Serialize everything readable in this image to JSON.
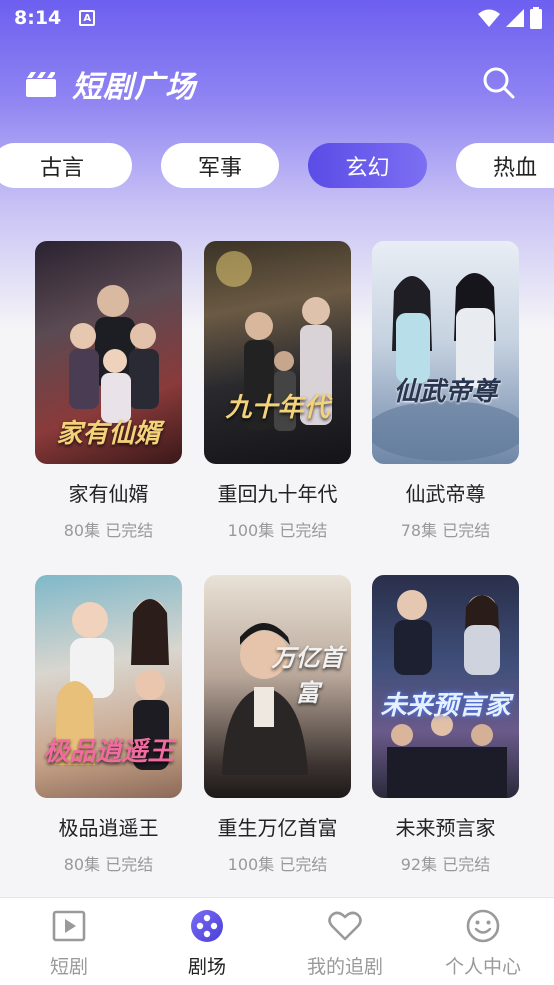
{
  "status": {
    "time": "8:14",
    "notif_letter": "A"
  },
  "header": {
    "title": "短剧广场"
  },
  "tabs": [
    {
      "label": "古言",
      "active": false
    },
    {
      "label": "军事",
      "active": false
    },
    {
      "label": "玄幻",
      "active": true
    },
    {
      "label": "热血",
      "active": false
    }
  ],
  "dramas": [
    {
      "title": "家有仙婿",
      "episodes": "80集",
      "status": "已完结",
      "poster_text": "家有仙婿"
    },
    {
      "title": "重回九十年代",
      "episodes": "100集",
      "status": "已完结",
      "poster_text": "九十年代"
    },
    {
      "title": "仙武帝尊",
      "episodes": "78集",
      "status": "已完结",
      "poster_text": "仙武帝尊"
    },
    {
      "title": "极品逍遥王",
      "episodes": "80集",
      "status": "已完结",
      "poster_text": "极品逍遥王"
    },
    {
      "title": "重生万亿首富",
      "episodes": "100集",
      "status": "已完结",
      "poster_text": "万亿首富"
    },
    {
      "title": "未来预言家",
      "episodes": "92集",
      "status": "已完结",
      "poster_text": "未来预言家"
    }
  ],
  "nav": [
    {
      "label": "短剧",
      "icon": "play-square-icon",
      "active": false
    },
    {
      "label": "剧场",
      "icon": "theater-reel-icon",
      "active": true
    },
    {
      "label": "我的追剧",
      "icon": "heart-icon",
      "active": false
    },
    {
      "label": "个人中心",
      "icon": "smile-face-icon",
      "active": false
    }
  ],
  "colors": {
    "accent": "#5a4ce6",
    "hero_top": "#6d5ff0"
  }
}
